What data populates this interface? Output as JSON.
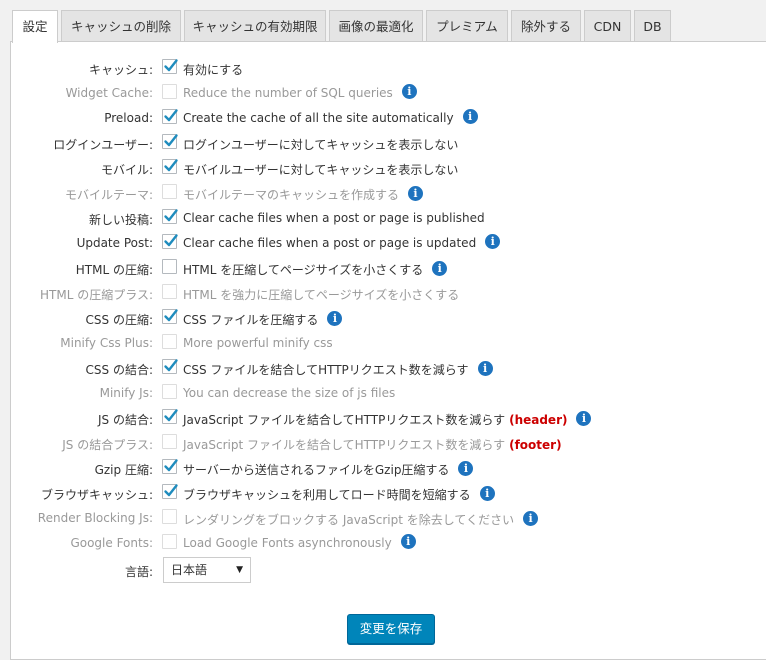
{
  "tabs": [
    "設定",
    "キャッシュの削除",
    "キャッシュの有効期限",
    "画像の最適化",
    "プレミアム",
    "除外する",
    "CDN",
    "DB"
  ],
  "settings": [
    {
      "label": "キャッシュ:",
      "text": "有効にする",
      "checked": true,
      "disabled": false,
      "info": false,
      "tag": ""
    },
    {
      "label": "Widget Cache:",
      "text": "Reduce the number of SQL queries",
      "checked": false,
      "disabled": true,
      "info": true,
      "tag": ""
    },
    {
      "label": "Preload:",
      "text": "Create the cache of all the site automatically",
      "checked": true,
      "disabled": false,
      "info": true,
      "tag": ""
    },
    {
      "label": "ログインユーザー:",
      "text": "ログインユーザーに対してキャッシュを表示しない",
      "checked": true,
      "disabled": false,
      "info": false,
      "tag": ""
    },
    {
      "label": "モバイル:",
      "text": "モバイルユーザーに対してキャッシュを表示しない",
      "checked": true,
      "disabled": false,
      "info": false,
      "tag": ""
    },
    {
      "label": "モバイルテーマ:",
      "text": "モバイルテーマのキャッシュを作成する",
      "checked": false,
      "disabled": true,
      "info": true,
      "tag": ""
    },
    {
      "label": "新しい投稿:",
      "text": "Clear cache files when a post or page is published",
      "checked": true,
      "disabled": false,
      "info": false,
      "tag": ""
    },
    {
      "label": "Update Post:",
      "text": "Clear cache files when a post or page is updated",
      "checked": true,
      "disabled": false,
      "info": true,
      "tag": ""
    },
    {
      "label": "HTML の圧縮:",
      "text": "HTML を圧縮してページサイズを小さくする",
      "checked": false,
      "disabled": false,
      "info": true,
      "tag": ""
    },
    {
      "label": "HTML の圧縮プラス:",
      "text": "HTML を強力に圧縮してページサイズを小さくする",
      "checked": false,
      "disabled": true,
      "info": false,
      "tag": ""
    },
    {
      "label": "CSS の圧縮:",
      "text": "CSS ファイルを圧縮する",
      "checked": true,
      "disabled": false,
      "info": true,
      "tag": ""
    },
    {
      "label": "Minify Css Plus:",
      "text": "More powerful minify css",
      "checked": false,
      "disabled": true,
      "info": false,
      "tag": ""
    },
    {
      "label": "CSS の結合:",
      "text": "CSS ファイルを結合してHTTPリクエスト数を減らす",
      "checked": true,
      "disabled": false,
      "info": true,
      "tag": ""
    },
    {
      "label": "Minify Js:",
      "text": "You can decrease the size of js files",
      "checked": false,
      "disabled": true,
      "info": false,
      "tag": ""
    },
    {
      "label": "JS の結合:",
      "text": "JavaScript ファイルを結合してHTTPリクエスト数を減らす",
      "checked": true,
      "disabled": false,
      "info": true,
      "tag": "(header)"
    },
    {
      "label": "JS の結合プラス:",
      "text": "JavaScript ファイルを結合してHTTPリクエスト数を減らす",
      "checked": false,
      "disabled": true,
      "info": false,
      "tag": "(footer)"
    },
    {
      "label": "Gzip 圧縮:",
      "text": "サーバーから送信されるファイルをGzip圧縮する",
      "checked": true,
      "disabled": false,
      "info": true,
      "tag": ""
    },
    {
      "label": "ブラウザキャッシュ:",
      "text": "ブラウザキャッシュを利用してロード時間を短縮する",
      "checked": true,
      "disabled": false,
      "info": true,
      "tag": ""
    },
    {
      "label": "Render Blocking Js:",
      "text": "レンダリングをブロックする JavaScript を除去してください",
      "checked": false,
      "disabled": true,
      "info": true,
      "tag": ""
    },
    {
      "label": "Google Fonts:",
      "text": "Load Google Fonts asynchronously",
      "checked": false,
      "disabled": true,
      "info": true,
      "tag": ""
    }
  ],
  "language": {
    "label": "言語:",
    "value": "日本語",
    "arrow": "▼"
  },
  "info_glyph": "i",
  "save_label": "変更を保存",
  "colors": {
    "accent": "#0085ba",
    "info": "#1e73be",
    "tag": "#cc0000"
  }
}
